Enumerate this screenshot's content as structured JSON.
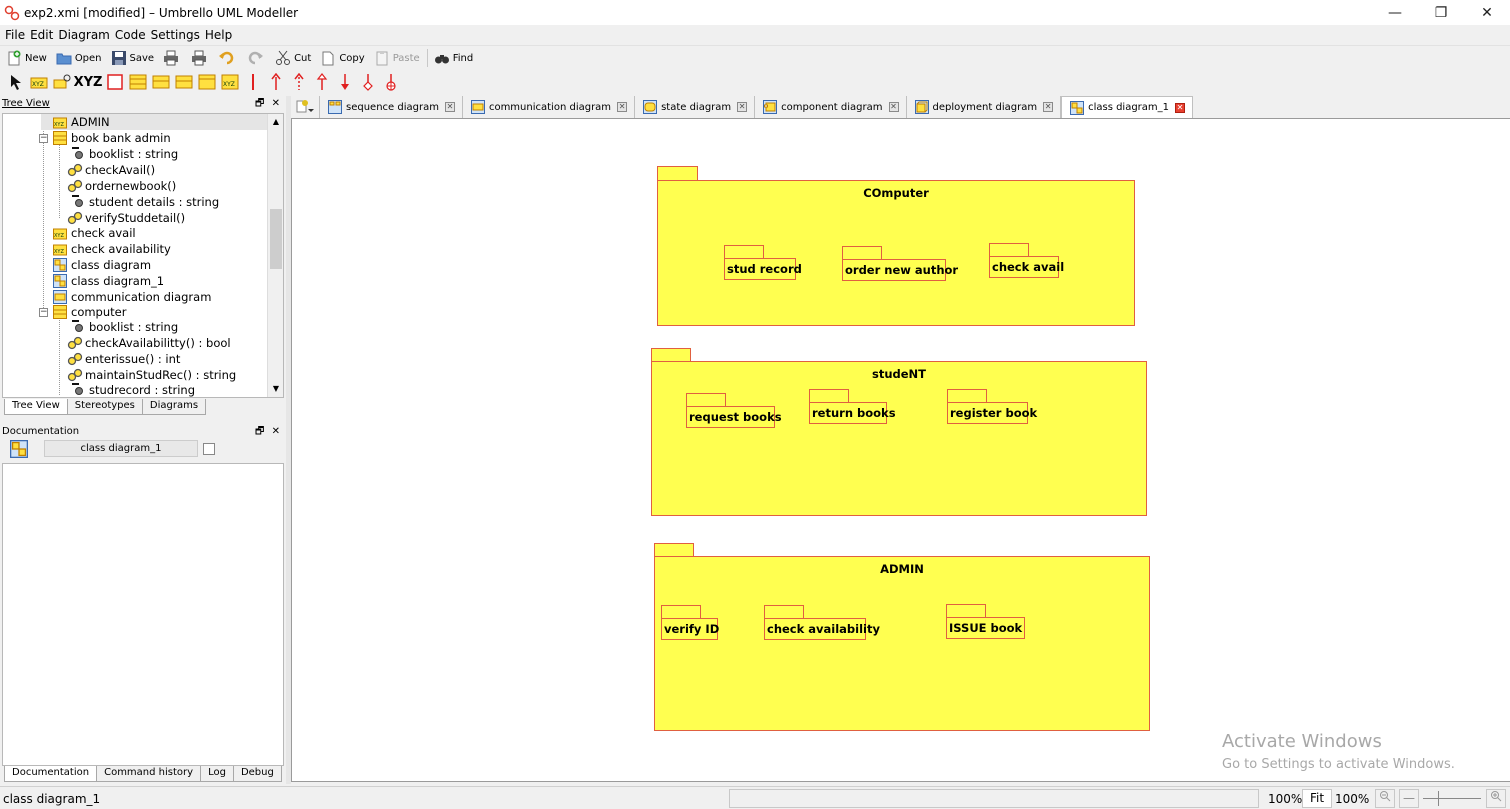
{
  "window": {
    "title": "exp2.xmi [modified] – Umbrello UML Modeller",
    "minimize": "—",
    "restore": "❐",
    "close": "✕"
  },
  "menu": [
    "File",
    "Edit",
    "Diagram",
    "Code",
    "Settings",
    "Help"
  ],
  "toolbar": {
    "new": "New",
    "open": "Open",
    "save": "Save",
    "cut": "Cut",
    "copy": "Copy",
    "paste": "Paste",
    "find": "Find",
    "xyz": "XYZ"
  },
  "tree_panel": {
    "title": "Tree View",
    "controls": "🗗 ✕",
    "items": [
      {
        "label": "ADMIN",
        "icon": "package-icon"
      },
      {
        "label": "book bank admin",
        "icon": "class-icon"
      },
      {
        "label": "booklist : string",
        "icon": "attribute-icon"
      },
      {
        "label": "checkAvail()",
        "icon": "operation-icon"
      },
      {
        "label": "ordernewbook()",
        "icon": "operation-icon"
      },
      {
        "label": "student details : string",
        "icon": "attribute-icon"
      },
      {
        "label": "verifyStuddetail()",
        "icon": "operation-icon"
      },
      {
        "label": "check avail",
        "icon": "package-icon"
      },
      {
        "label": "check availability",
        "icon": "package-icon"
      },
      {
        "label": "class diagram",
        "icon": "class-diagram-icon"
      },
      {
        "label": "class diagram_1",
        "icon": "class-diagram-icon"
      },
      {
        "label": "communication diagram",
        "icon": "communication-diagram-icon"
      },
      {
        "label": "computer",
        "icon": "class-icon"
      },
      {
        "label": "booklist : string",
        "icon": "attribute-icon"
      },
      {
        "label": "checkAvailabilitty() : bool",
        "icon": "operation-icon"
      },
      {
        "label": "enterissue() : int",
        "icon": "operation-icon"
      },
      {
        "label": "maintainStudRec() : string",
        "icon": "operation-icon"
      },
      {
        "label": "studrecord : string",
        "icon": "attribute-icon"
      }
    ],
    "tabs": [
      "Tree View",
      "Stereotypes",
      "Diagrams"
    ]
  },
  "doc_panel": {
    "title": "Documentation",
    "controls": "🗗 ✕",
    "name_value": "class diagram_1",
    "tabs": [
      "Documentation",
      "Command history",
      "Log",
      "Debug"
    ]
  },
  "diagram_tabs": [
    {
      "label": "sequence diagram",
      "active": false
    },
    {
      "label": "communication diagram",
      "active": false
    },
    {
      "label": "state diagram",
      "active": false
    },
    {
      "label": "component diagram",
      "active": false
    },
    {
      "label": "deployment diagram",
      "active": false
    },
    {
      "label": "class diagram_1",
      "active": true
    }
  ],
  "diagram": {
    "packages": [
      {
        "name": "COmputer",
        "children": [
          "stud record",
          "order new author",
          "check avail"
        ]
      },
      {
        "name": "studeNT",
        "children": [
          "request books",
          "return books",
          "register book"
        ]
      },
      {
        "name": "ADMIN",
        "children": [
          "verify ID",
          "check availability",
          "ISSUE book"
        ]
      }
    ],
    "colors": {
      "fill": "#ffff50",
      "border": "#e06040"
    }
  },
  "watermark": {
    "line1": "Activate Windows",
    "line2": "Go to Settings to activate Windows."
  },
  "status": {
    "message": "class diagram_1",
    "zoom_left": "100%",
    "fit": "Fit",
    "zoom_right": "100%",
    "zoom_out": "🔍",
    "zoom_minus": "—",
    "zoom_in": "🔍"
  }
}
